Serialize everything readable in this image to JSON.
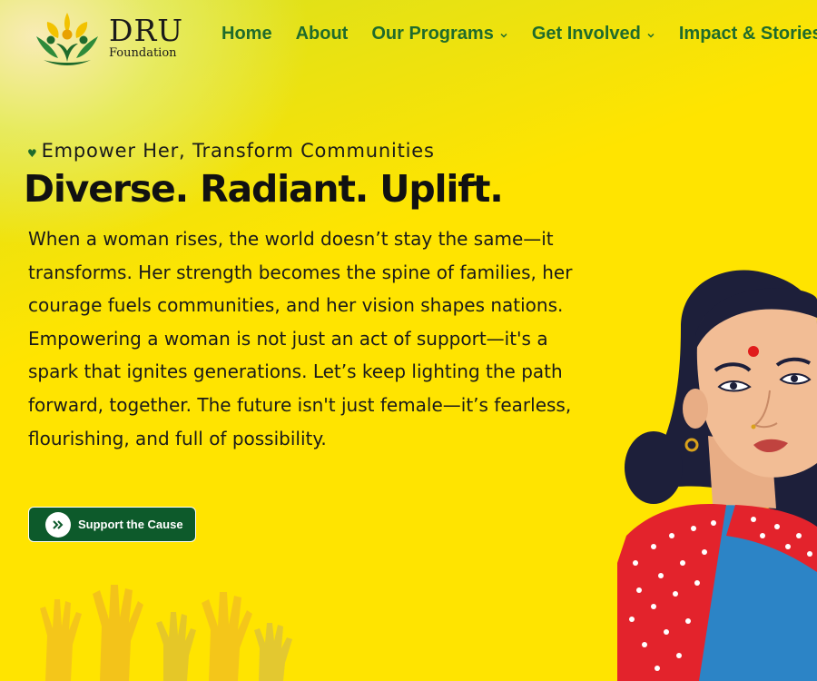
{
  "brand": {
    "name": "DRU",
    "subtitle": "Foundation",
    "logo_icon": "people-lotus-logo-icon",
    "colors": {
      "primary_green": "#1f6b2c",
      "button_green": "#0d5a2b",
      "background_yellow": "#ffe400"
    }
  },
  "nav": {
    "items": [
      {
        "label": "Home",
        "has_dropdown": false
      },
      {
        "label": "About",
        "has_dropdown": false
      },
      {
        "label": "Our Programs",
        "has_dropdown": true
      },
      {
        "label": "Get Involved",
        "has_dropdown": true
      },
      {
        "label": "Impact & Stories",
        "has_dropdown": false
      }
    ]
  },
  "hero": {
    "tagline_icon": "heart-icon",
    "tagline": "Empower Her, Transform Communities",
    "headline": "Diverse. Radiant. Uplift.",
    "body": "When a woman rises, the world doesn’t stay the same—it transforms. Her strength becomes the spine of families, her courage fuels communities, and her vision shapes nations. Empowering a woman is not just an act of support—it's a spark that ignites generations. Let’s keep lighting the path forward, together. The future isn't just female—it’s fearless, flourishing, and full of possibility.",
    "cta": {
      "label": "Support the Cause",
      "icon": "double-chevron-right-icon"
    },
    "decoration_icon": "raised-hands-icon",
    "illustration_icon": "woman-in-saree-illustration"
  }
}
